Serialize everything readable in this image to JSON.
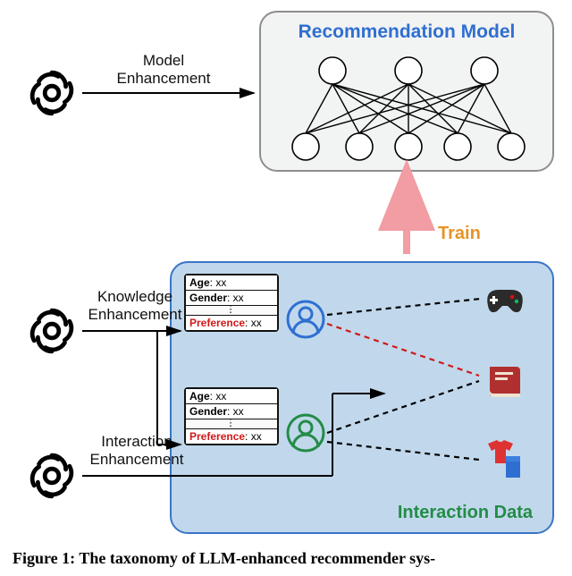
{
  "rec_model": {
    "title": "Recommendation Model"
  },
  "labels": {
    "model_enh": "Model\nEnhancement",
    "knowledge_enh": "Knowledge\nEnhancement",
    "interaction_enh": "Interaction\nEnhancement",
    "train": "Train"
  },
  "interaction_panel": {
    "title": "Interaction Data"
  },
  "profile1": {
    "age_key": "Age",
    "age_val": ": xx",
    "gender_key": "Gender",
    "gender_val": ": xx",
    "pref_key": "Preference",
    "pref_val": ": xx"
  },
  "profile2": {
    "age_key": "Age",
    "age_val": ": xx",
    "gender_key": "Gender",
    "gender_val": ": xx",
    "pref_key": "Preference",
    "pref_val": ": xx"
  },
  "icons": {
    "llm": "openai-logo-icon",
    "user_blue": "user-icon",
    "user_green": "user-icon",
    "game": "game-controller-icon",
    "book": "book-icon",
    "clothes": "clothes-icon",
    "arrow_up": "arrow-up-icon"
  },
  "colors": {
    "blue": "#2f6fd1",
    "green": "#238c46",
    "red": "#d11919",
    "orange": "#e79327",
    "pink_arrow": "#f29ca3"
  },
  "caption": "Figure 1: The taxonomy of LLM-enhanced recommender sys-"
}
